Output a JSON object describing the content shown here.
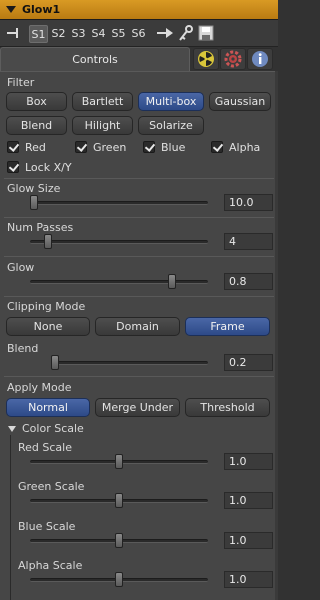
{
  "title": "Glow1",
  "slots": [
    "S1",
    "S2",
    "S3",
    "S4",
    "S5",
    "S6"
  ],
  "active_slot": "S1",
  "tabs": {
    "controls": "Controls"
  },
  "tab_icons": [
    "radioactive-icon",
    "gear-icon",
    "info-icon"
  ],
  "filter": {
    "label": "Filter",
    "buttons": [
      "Box",
      "Bartlett",
      "Multi-box",
      "Gaussian",
      "Blend",
      "Hilight",
      "Solarize"
    ],
    "selected": "Multi-box"
  },
  "channels": {
    "red": "Red",
    "green": "Green",
    "blue": "Blue",
    "alpha": "Alpha",
    "lock": "Lock X/Y"
  },
  "sliders": {
    "glow_size": {
      "label": "Glow Size",
      "value": "10.0",
      "fraction": 0.02
    },
    "num_passes": {
      "label": "Num Passes",
      "value": "4",
      "fraction": 0.1
    },
    "glow": {
      "label": "Glow",
      "value": "0.8",
      "fraction": 0.8
    },
    "blend": {
      "label": "Blend",
      "value": "0.2",
      "fraction": 0.02
    },
    "red_scale": {
      "label": "Red Scale",
      "value": "1.0",
      "fraction": 0.5
    },
    "green_scale": {
      "label": "Green Scale",
      "value": "1.0",
      "fraction": 0.5
    },
    "blue_scale": {
      "label": "Blue Scale",
      "value": "1.0",
      "fraction": 0.5
    },
    "alpha_scale": {
      "label": "Alpha Scale",
      "value": "1.0",
      "fraction": 0.5
    }
  },
  "clipping": {
    "label": "Clipping Mode",
    "buttons": [
      "None",
      "Domain",
      "Frame"
    ],
    "selected": "Frame"
  },
  "apply": {
    "label": "Apply Mode",
    "buttons": [
      "Normal",
      "Merge Under",
      "Threshold"
    ],
    "selected": "Normal"
  },
  "color_scale": {
    "label": "Color Scale",
    "expanded": true
  }
}
